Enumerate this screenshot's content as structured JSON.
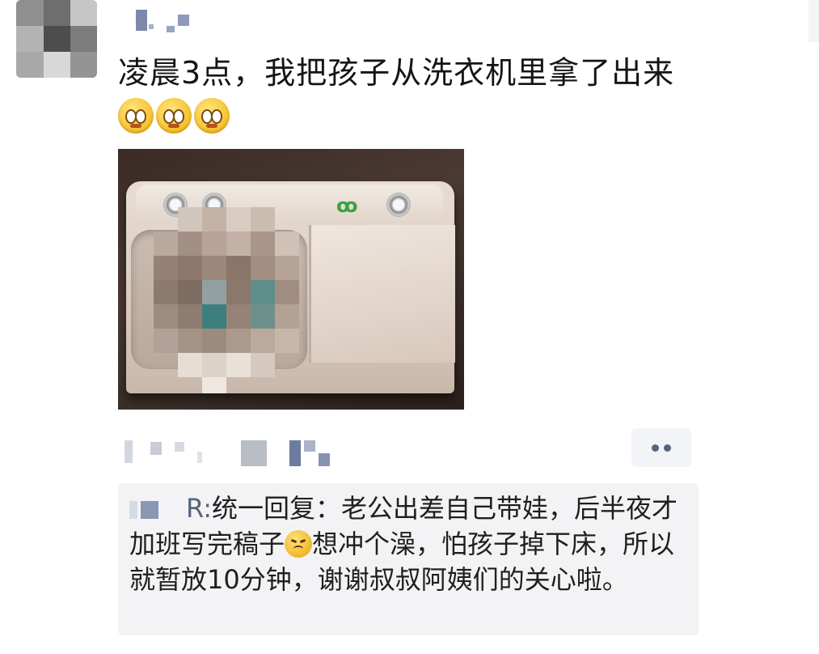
{
  "post": {
    "avatar_icon": "avatar-pixelated",
    "author_name_icon": "name-pixelated",
    "text": "凌晨3点，我把孩子从洗衣机里拿了出来",
    "emoji_count": 3,
    "emoji_icon": "dizzy-face-emoji-icon",
    "image_icon": "twin-tub-washing-machine-photo"
  },
  "meta": {
    "liker_names_icon": "liker-names-pixelated",
    "more_icon": "two-dots-icon"
  },
  "comment": {
    "author_icon": "commenter-name-pixelated",
    "author_suffix": "R:",
    "text_before_emoji": "统一回复：老公出差自己带娃，后半夜才加班写完稿子",
    "emoji_icon": "sad-face-emoji-icon",
    "text_after_emoji": "想冲个澡，怕孩子掉下床，所以就暂放10分钟，谢谢叔叔阿姨们的关心啦。"
  },
  "colors": {
    "background": "#ffffff",
    "comment_bg": "#f3f3f5",
    "link_blue": "#56637e",
    "text": "#151515"
  }
}
